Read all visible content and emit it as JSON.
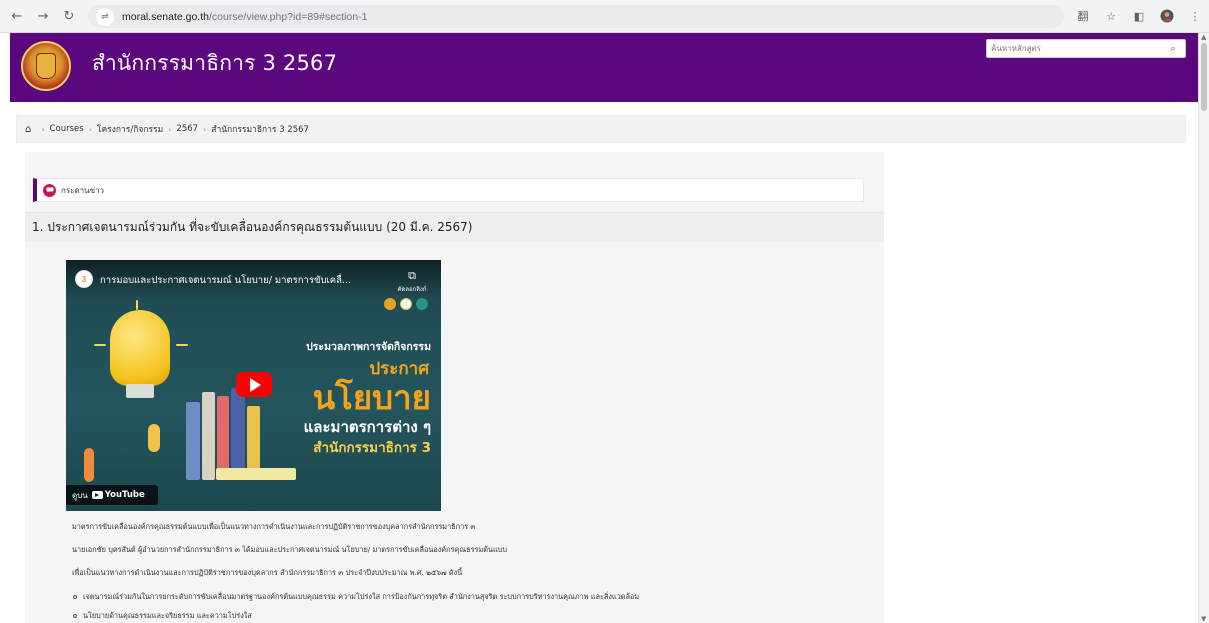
{
  "browser": {
    "url_host": "moral.senate.go.th",
    "url_path": "/course/view.php?id=89#section-1"
  },
  "header": {
    "site_title": "สำนักกรรมาธิการ 3 2567",
    "search_placeholder": "ค้นหาหลักสูตร"
  },
  "breadcrumb": {
    "items": [
      "Courses",
      "โครงการ/กิจกรรม",
      "2567",
      "สำนักกรรมาธิการ 3 2567"
    ]
  },
  "announcements": {
    "label": "กระดานข่าว"
  },
  "section": {
    "title": "1. ประกาศเจตนารมณ์ร่วมกัน ที่จะขับเคลื่อนองค์กรคุณธรรมต้นแบบ (20 มี.ค. 2567)"
  },
  "video": {
    "channel_badge": "3",
    "title": "การมอบและประกาศเจตนารมณ์ นโยบาย/ มาตรการขับเคลื่...",
    "copy_link_label": "คัดลอกลิงก์",
    "headline_small": "ประมวลภาพการจัดกิจกรรม",
    "headline_orange": "ประกาศ",
    "headline_big": "นโยบาย",
    "headline_white": "และมาตรการต่าง ๆ",
    "headline_yellow": "สำนักกรรมาธิการ 3",
    "watch_on": "ดูบน",
    "youtube": "YouTube"
  },
  "description": {
    "lines": [
      "มาตรการขับเคลื่อนองค์กรคุณธรรมต้นแบบเพื่อเป็นแนวทางการดำเนินงานและการปฏิบัติราชการของบุคลากรสำนักกรรมาธิการ ๓",
      "นายเอกชัย บุตรสันต์ ผู้อำนวยการสำนักกรรมาธิการ ๓ ได้มอบและประกาศเจตนารมณ์ นโยบาย/ มาตรการขับเคลื่อนองค์กรคุณธรรมต้นแบบ",
      "เพื่อเป็นแนวทางการดำเนินงานและการปฏิบัติราชการของบุคลากร สำนักกรรมาธิการ ๓ ประจำปีงบประมาณ พ.ศ. ๒๕๖๗ ดังนี้"
    ],
    "bullets": [
      "เจตนารมณ์ร่วมกันในการยกระดับการขับเคลื่อนมาตรฐานองค์กรต้นแบบคุณธรรม ความโปร่งใส การป้องกันการทุจริต สำนักงานสุจริต ระบบการบริหารงานคุณภาพ และสิ่งแวดล้อม",
      "นโยบายด้านคุณธรรมและจริยธรรม และความโปร่งใส"
    ]
  },
  "colors": {
    "header_bg": "#5b087f",
    "youtube_red": "#ff0000",
    "accent_orange": "#f3a41c"
  },
  "icons": {
    "back": "←",
    "forward": "→",
    "reload": "↻",
    "site_info": "⇌",
    "translate": "翻",
    "star": "☆",
    "sidepanel": "◧",
    "menu": "⋮",
    "home": "⌂",
    "search": "⌕",
    "copy": "⧉",
    "chevron": "›"
  }
}
